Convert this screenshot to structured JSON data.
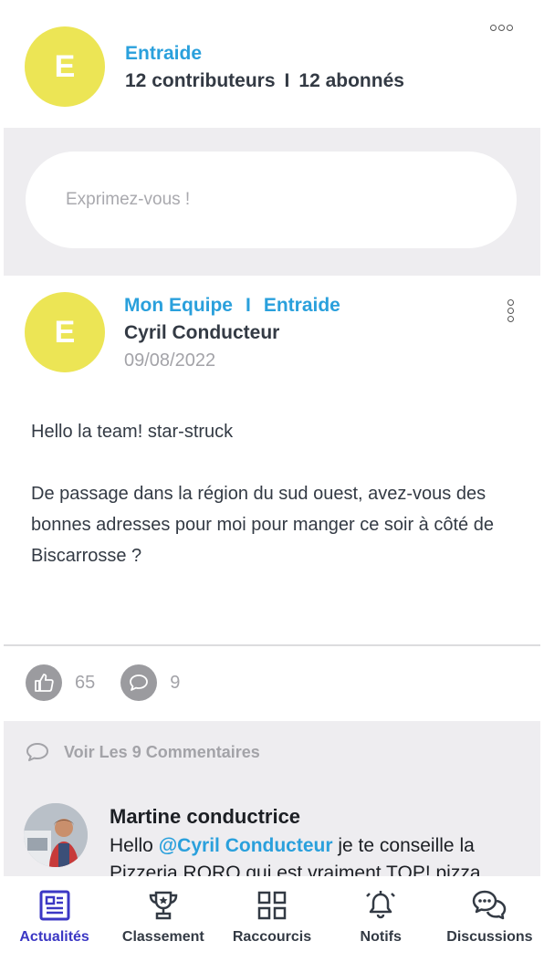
{
  "group": {
    "initial": "E",
    "name": "Entraide",
    "contributors": "12 contributeurs",
    "separator": "I",
    "followers": "12 abonnés"
  },
  "compose": {
    "placeholder": "Exprimez-vous !"
  },
  "post": {
    "initial": "E",
    "group_primary": "Mon Equipe",
    "separator": "I",
    "group_secondary": "Entraide",
    "author": "Cyril Conducteur",
    "date": "09/08/2022",
    "paragraph_1": "Hello la team! star-struck",
    "paragraph_2": "De passage dans la région du sud ouest, avez-vous des bonnes adresses pour moi pour manger ce soir à côté de Biscarrosse ?",
    "likes": "65",
    "comments": "9"
  },
  "comments_link": {
    "label": "Voir Les 9 Commentaires"
  },
  "comment": {
    "author": "Martine conductrice",
    "text_before": "Hello ",
    "mention": "@Cyril Conducteur",
    "text_after": " je te conseille la Pizzeria RORO qui est vraiment TOP! pizza"
  },
  "nav": {
    "items": [
      {
        "label": "Actualités",
        "icon": "news-icon",
        "active": true
      },
      {
        "label": "Classement",
        "icon": "trophy-icon",
        "active": false
      },
      {
        "label": "Raccourcis",
        "icon": "grid-icon",
        "active": false
      },
      {
        "label": "Notifs",
        "icon": "bell-icon",
        "active": false
      },
      {
        "label": "Discussions",
        "icon": "chat-bubbles-icon",
        "active": false
      }
    ]
  },
  "colors": {
    "accent": "#2aa0dc",
    "avatar": "#ece555",
    "active_nav": "#3b37c4",
    "band": "#eeedf0"
  }
}
